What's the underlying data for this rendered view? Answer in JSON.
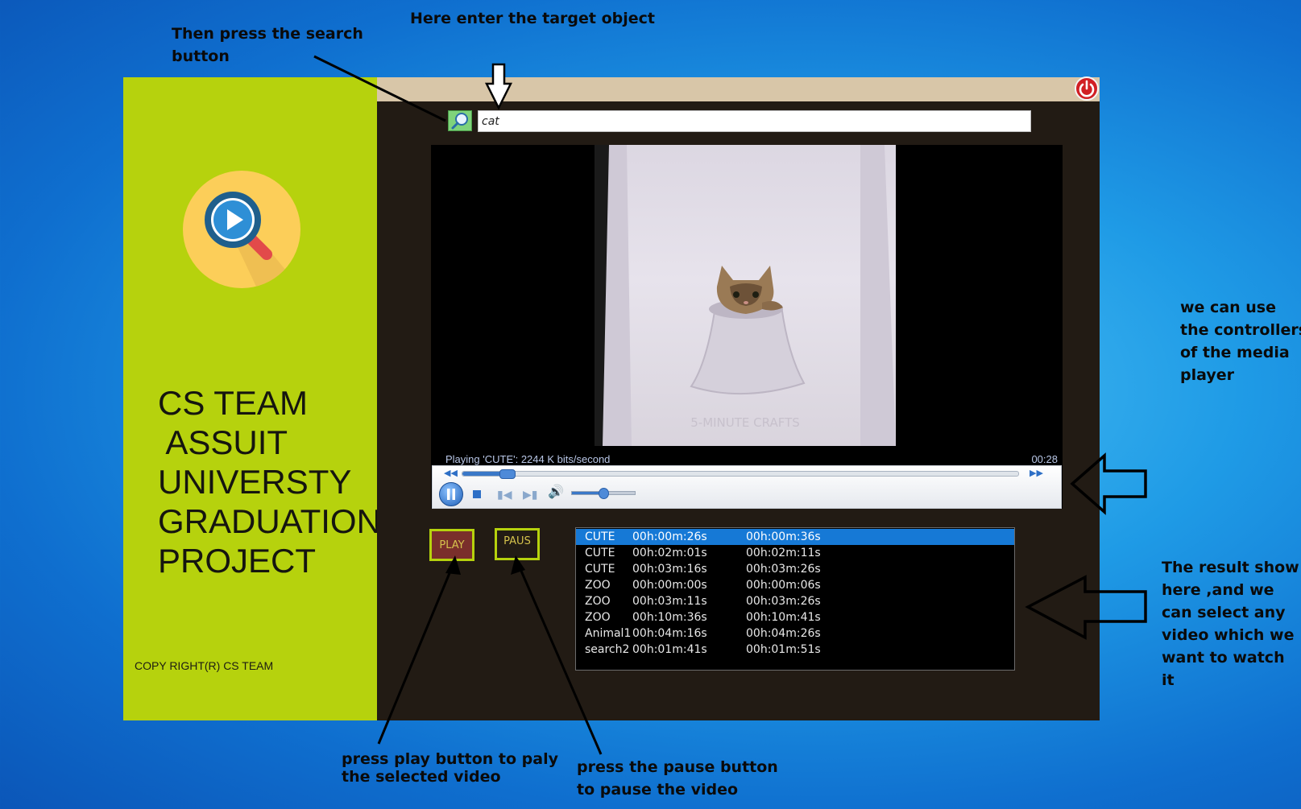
{
  "annotations": {
    "enter_target": "Here enter the target object",
    "press_search": "Then press the search\nbutton",
    "controllers": "we can use\nthe controllers\nof the media\nplayer",
    "results": "The result show\nhere ,and we\ncan select any\nvideo which we\nwant to watch\nit",
    "press_play": "press play button to paly\nthe selected video",
    "press_pause": "press the pause button\nto pause the video"
  },
  "sidebar": {
    "title": "CS TEAM\n ASSUIT\nUNIVERSTY\nGRADUATION\nPROJECT",
    "copyright": "COPY RIGHT(R) CS TEAM"
  },
  "search": {
    "value": "cat"
  },
  "player": {
    "status": "Playing 'CUTE': 2244 K bits/second",
    "time": "00:28",
    "seek_percent": 8,
    "volume_percent": 50,
    "watermark": "5-MINUTE CRAFTS"
  },
  "buttons": {
    "play": "PLAY",
    "pause": "PAUS"
  },
  "results": [
    {
      "name": "CUTE",
      "start": "00h:00m:26s",
      "end": "00h:00m:36s",
      "selected": true
    },
    {
      "name": "CUTE",
      "start": "00h:02m:01s",
      "end": "00h:02m:11s"
    },
    {
      "name": "CUTE",
      "start": "00h:03m:16s",
      "end": "00h:03m:26s"
    },
    {
      "name": "ZOO",
      "start": "00h:00m:00s",
      "end": "00h:00m:06s"
    },
    {
      "name": "ZOO",
      "start": "00h:03m:11s",
      "end": "00h:03m:26s"
    },
    {
      "name": "ZOO",
      "start": "00h:10m:36s",
      "end": "00h:10m:41s"
    },
    {
      "name": "Animal1",
      "start": "00h:04m:16s",
      "end": "00h:04m:26s"
    },
    {
      "name": "search2",
      "start": "00h:01m:41s",
      "end": "00h:01m:51s"
    }
  ],
  "colors": {
    "sidebar": "#b6d20d",
    "window": "#221b14",
    "selection": "#1679d6",
    "play_button": "#7a2f2b"
  }
}
